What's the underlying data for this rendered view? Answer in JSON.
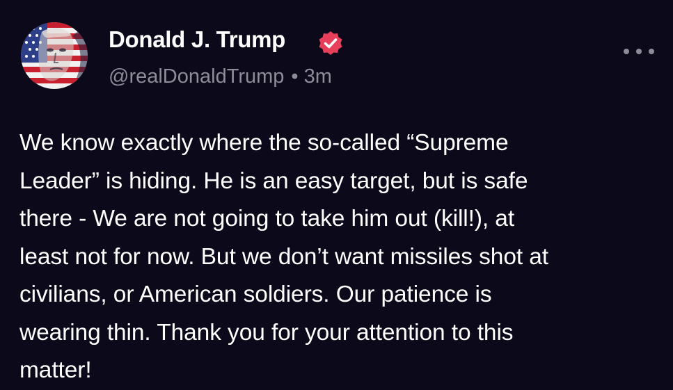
{
  "author": {
    "display_name": "Donald J. Trump",
    "handle": "@realDonaldTrump",
    "separator": "•",
    "time_ago": "3m",
    "verified_icon": "verified-badge-icon",
    "avatar_icon": "profile-avatar"
  },
  "post": {
    "lines": [
      "We know exactly where the so-called “Supreme",
      "Leader” is hiding. He is an easy target, but is safe",
      "there - We are not going to take him out (kill!), at",
      "least not for now. But we don’t want missiles shot at",
      "civilians, or American soldiers. Our patience is",
      "wearing thin. Thank you for your attention to this",
      "matter!"
    ]
  },
  "menu": {
    "icon": "more-options-icon"
  },
  "colors": {
    "background": "#0c0a1a",
    "text": "#ffffff",
    "muted": "#8e8c99",
    "verified": "#e8405a"
  }
}
